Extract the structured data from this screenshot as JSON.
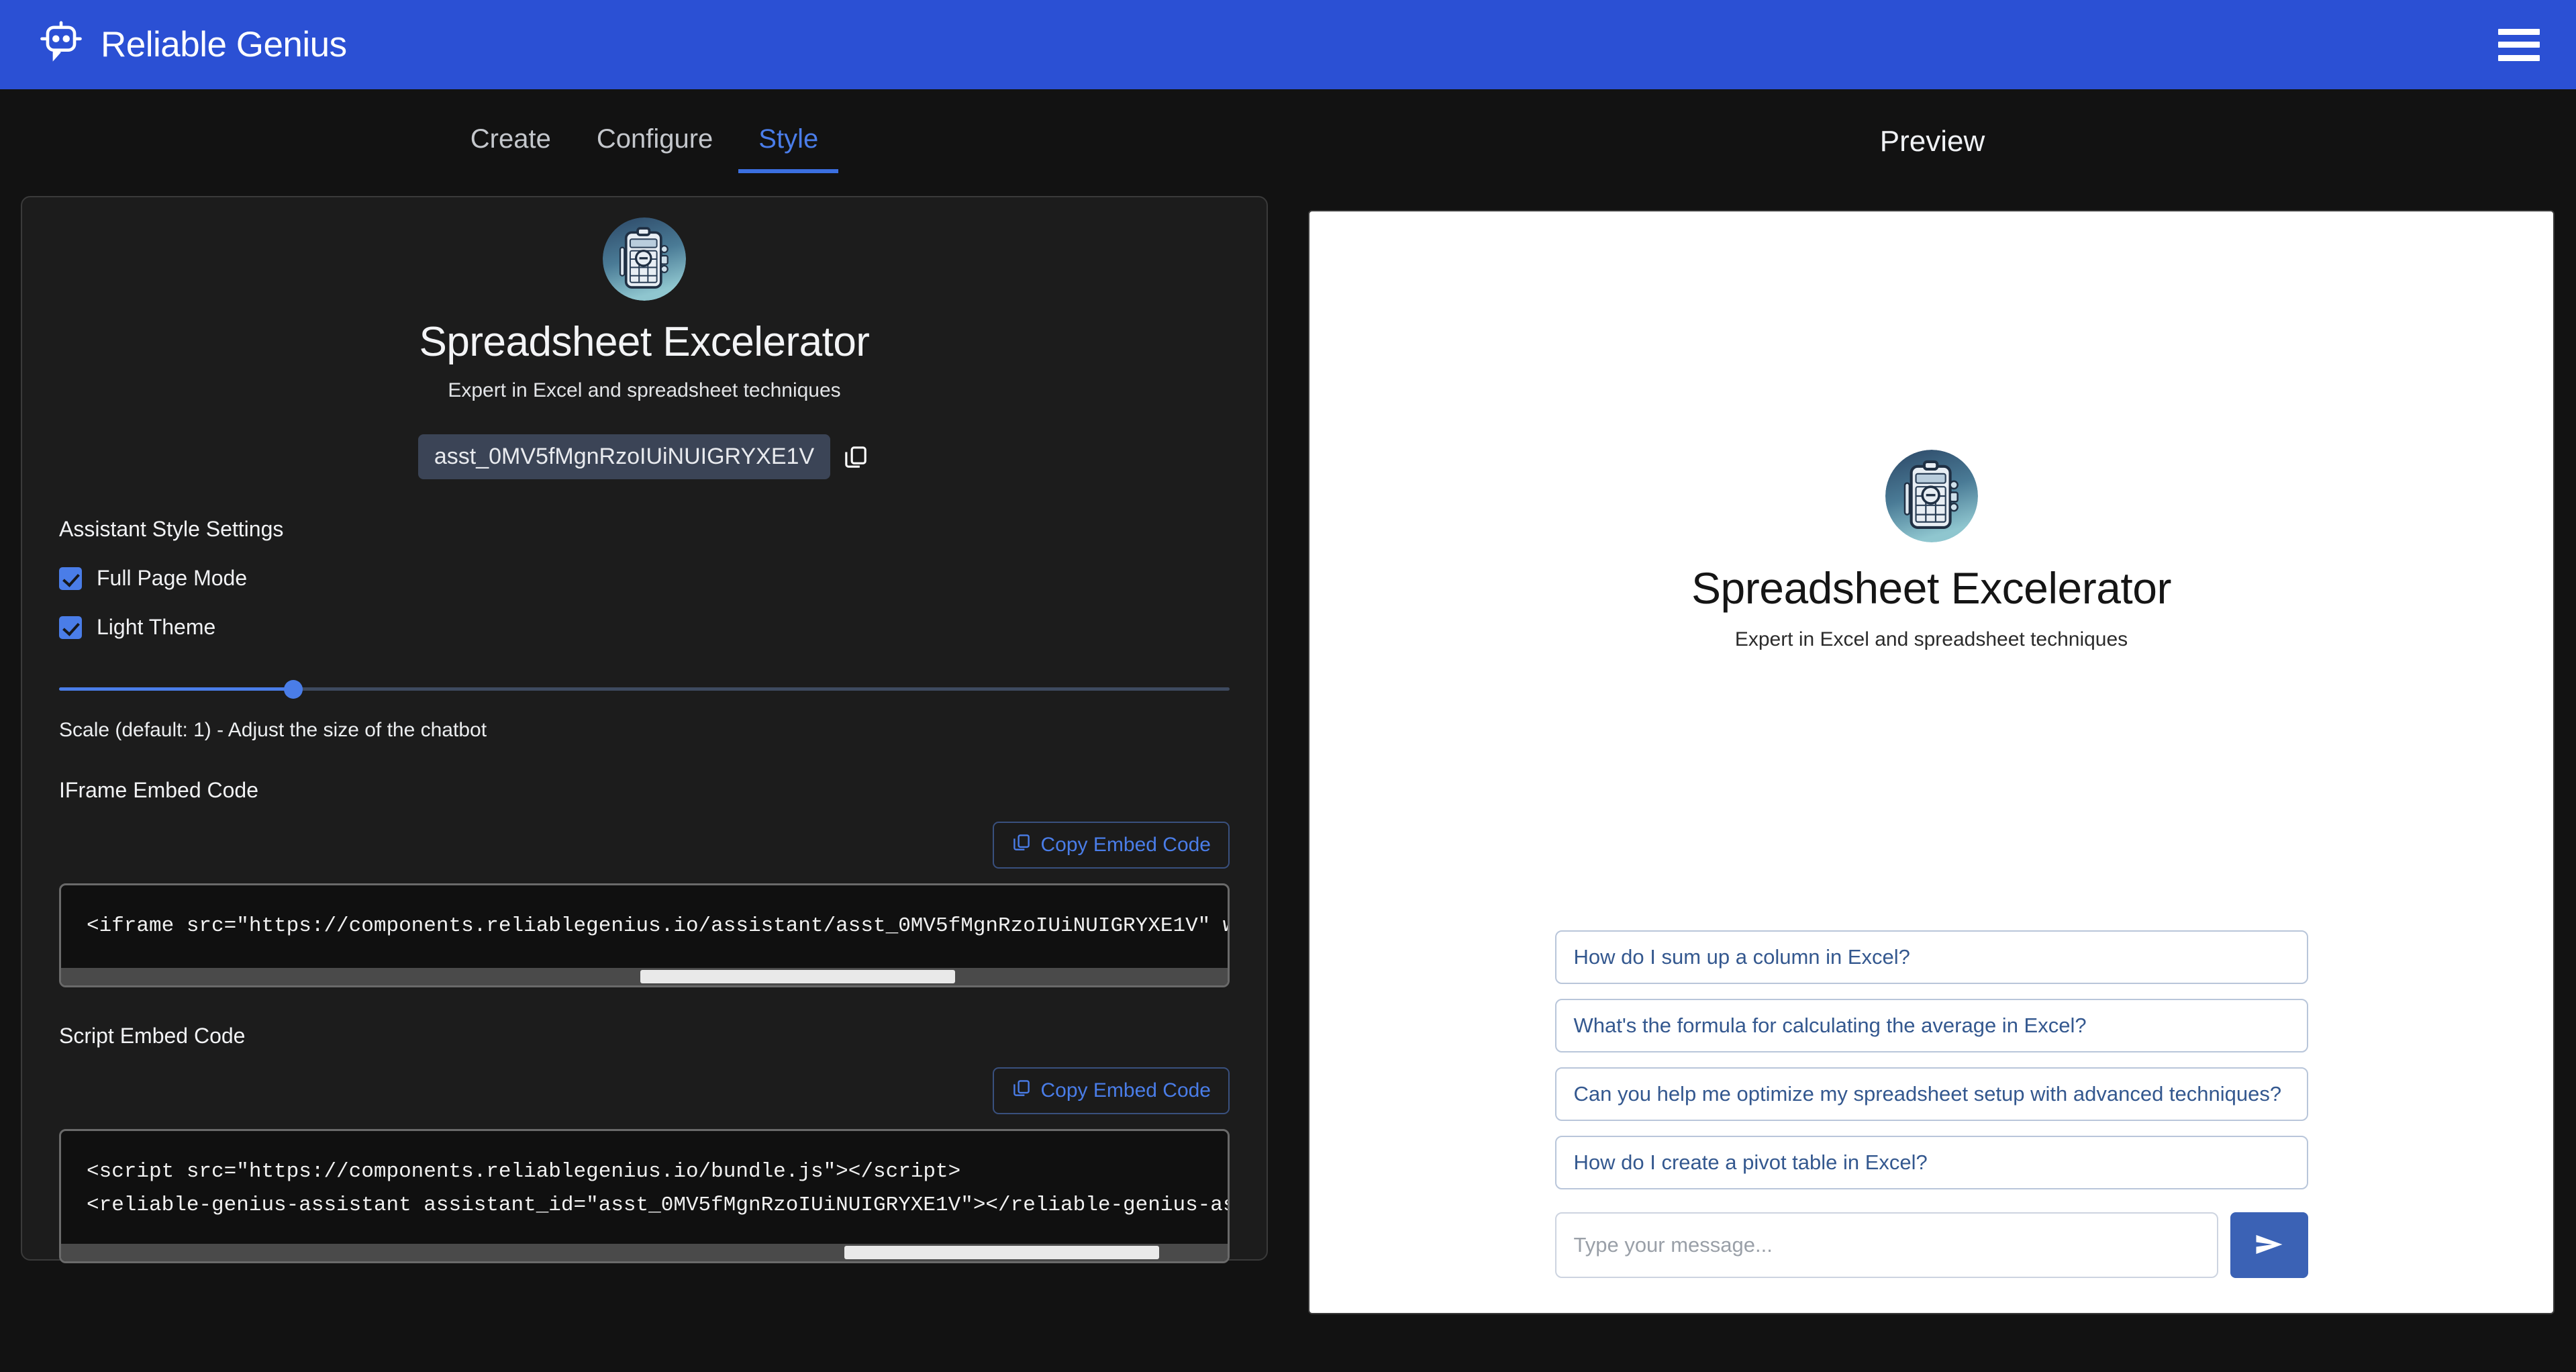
{
  "topbar": {
    "brand_name": "Reliable Genius",
    "logo_icon": "chatbot-logo-icon",
    "menu_icon": "hamburger-menu-icon"
  },
  "tabs": [
    {
      "label": "Create",
      "active": false
    },
    {
      "label": "Configure",
      "active": false
    },
    {
      "label": "Style",
      "active": true
    }
  ],
  "preview_header": {
    "title": "Preview"
  },
  "assistant": {
    "name": "Spreadsheet Excelerator",
    "description": "Expert in Excel and spreadsheet techniques",
    "id": "asst_0MV5fMgnRzoIUiNUIGRYXE1V",
    "copy_id_icon": "copy-icon",
    "avatar_icon": "spreadsheet-clipboard-avatar"
  },
  "settings": {
    "heading": "Assistant Style Settings",
    "checkboxes": [
      {
        "label": "Full Page Mode",
        "checked": true
      },
      {
        "label": "Light Theme",
        "checked": true
      }
    ],
    "scale_slider": {
      "caption": "Scale (default: 1) - Adjust the size of the chatbot",
      "percent": 20
    }
  },
  "iframe_embed": {
    "heading": "IFrame Embed Code",
    "copy_label": "Copy Embed Code",
    "copy_icon": "copy-icon",
    "code": "<iframe src=\"https://components.reliablegenius.io/assistant/asst_0MV5fMgnRzoIUiNUIGRYXE1V\" w",
    "scroll_percent": 68
  },
  "script_embed": {
    "heading": "Script Embed Code",
    "copy_label": "Copy Embed Code",
    "copy_icon": "copy-icon",
    "code": "<script src=\"https://components.reliablegenius.io/bundle.js\"></script>\n<reliable-genius-assistant assistant_id=\"asst_0MV5fMgnRzoIUiNUIGRYXE1V\"></reliable-genius-as",
    "scroll_percent": 92
  },
  "preview": {
    "suggestions": [
      "How do I sum up a column in Excel?",
      "What's the formula for calculating the average in Excel?",
      "Can you help me optimize my spreadsheet setup with advanced techniques?",
      "How do I create a pivot table in Excel?"
    ],
    "composer": {
      "placeholder": "Type your message...",
      "send_icon": "send-arrow-icon"
    }
  },
  "colors": {
    "brand_blue": "#2b50d4",
    "accent_blue": "#4a7de8",
    "send_blue": "#3b62b5",
    "page_bg": "#121212",
    "card_bg": "#1c1c1c"
  }
}
